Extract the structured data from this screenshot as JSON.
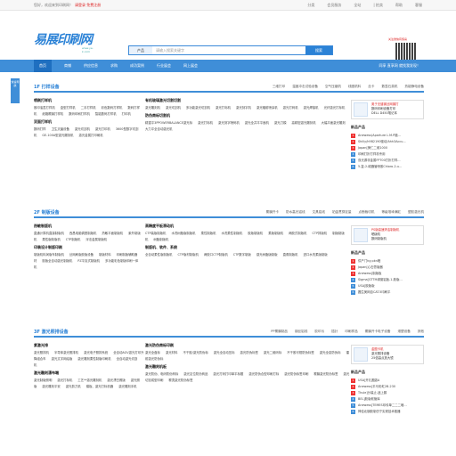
{
  "topbar": {
    "welcome": "您好，欢迎来到印刷网！",
    "register": "请登录 免费注册",
    "links": [
      "分类",
      "会员服务",
      "全站",
      "| 拍卖",
      "帮助",
      "客服"
    ]
  },
  "logo": {
    "text": "易展印刷网",
    "sub": "www.ye-k.com"
  },
  "search": {
    "category": "产品",
    "placeholder": "请输入搜索关键字",
    "button": "搜索"
  },
  "qr": {
    "label": "关注微信有惊喜"
  },
  "nav": {
    "items": [
      "首页",
      "商铺",
      "供应信息",
      "求购",
      "成功案例",
      "行业展会",
      "网上展会"
    ],
    "right": "同享 直享网 就找我发现！"
  },
  "side_tab": {
    "label": "快速导航"
  },
  "sections": [
    {
      "title": "1F 打样设备",
      "links": [
        "三维打印",
        "温度冲击试验设备",
        "空气压缩机",
        "线圈机料",
        "丝卡",
        "数显石英机",
        "热能静电设备"
      ],
      "cols": [
        {
          "groups": [
            {
              "title": "喷刷打样机",
              "items": [
                "胶印油墨打样机",
                "盒型打样机",
                "二手打样机",
                "彩色数码打样机",
                "数码打样机",
                "纸箱覆膜打样机",
                "数码印刷打样机",
                "智能数码打样机",
                "打印机"
              ]
            },
            {
              "title": "双面打样机",
              "items": [
                "数码打样",
                "卫生灭菌设备",
                "激光切割机",
                "激光打印机",
                "3600型数字切割机",
                "GE-100A型激光雕刻机",
                "激光金属打印刷机"
              ]
            }
          ]
        },
        {
          "groups": [
            {
              "title": "有机玻璃激光切割切割",
              "items": [
                "激光雕刻机",
                "激光切割机",
                "多功能激光切割机",
                "激光打标机",
                "激光刻字机",
                "激光辐射喷涂机",
                "激光打码机",
                "激光焊接机",
                "光纤激光打标机"
              ]
            },
            {
              "title": "防伪商标切割机",
              "items": [
                "精重平3PPOWERBALANCE激光标",
                "激光打标机",
                "激光刻字喷码机",
                "激光全并平平面机",
                "激光刀模",
                "高精密激光雕刻机",
                "大幅平面激光雕刻",
                "大力平全自动激光机"
              ]
            }
          ]
        }
      ],
      "side": {
        "promo": {
          "highlight": "奥于无缝钢丝网钢打",
          "lines": [
            "数码印刷设备打印",
            "DELL D450笔记本"
          ]
        },
        "rank_title": "新品产品",
        "rank": [
          "Anewess(Aparture L.M.P植...",
          "Shilly/h9B2190驱动/Ahh3Accu...",
          "Japan[美仁二维1000",
          "印刷打折打样机专用",
          "双光源非金属FPT00打折打样...",
          "5-复-2-磁器管喷胶Chloro-2-u..."
        ]
      }
    },
    {
      "title": "2F 制版设备",
      "links": [
        "覆膜开卡",
        "防水高光铝线",
        "文具铝线",
        "铂金贯穿定量",
        "点断裁切机",
        "等级堆垛满缸",
        "塑胶激光机"
      ],
      "cols": [
        {
          "groups": [
            {
              "title": "热敏制版机",
              "items": [
                "直通计算机直接制版机",
                "西昌电脑调宽制版机",
                "热敏平面制版机",
                "紫外制版机",
                "柔性版制版机",
                "CTP制版机",
                "浮法金属制版机"
              ]
            },
            {
              "title": "印装设计制版印刷",
              "items": [
                "制版机料润版车制版机",
                "丝网刷版胶版设备",
                "制版材料",
                "印刷制版辅助器材",
                "胶版全自动激光制版机",
                "PZ平克式制版机",
                "多功能彩色制版印刷一体机"
              ]
            }
          ]
        },
        {
          "groups": [
            {
              "title": "高精度平板滑动机",
              "items": [
                "CTP装版制版机",
                "水洗树脂版制版机",
                "柔性制版机",
                "水洗柔性制版机",
                "胶版制版机",
                "柔版制版机",
                "两胶式制版机",
                "CTP排版机",
                "制版制版机",
                "树脂制版机"
              ]
            },
            {
              "title": "制版机、软件、系统",
              "items": [
                "全自动柔性版制版机",
                "CTP版材制版机",
                "两胶口CTP制版机",
                "CTP数字制版",
                "感光树脂版制版",
                "直角制版机",
                "进口水洗柔版制版"
              ]
            }
          ]
        }
      ],
      "side": {
        "promo": {
          "highlight": "PS版高速清洁制版机",
          "lines": [
            "晒版机",
            "数码制版机"
          ]
        },
        "rank_title": "新品产品",
        "rank": [
          "供产门hg pkn晒",
          "Japan[心石膏版器",
          "Anewess]制版板",
          "Sigma[GTTM绿窗铝板-1-胶版...",
          "USA]胶版版",
          "圆生美网自CAT.5印刷平"
        ]
      }
    },
    {
      "title": "3F 激光照排设备",
      "links": [
        "PP覆膜制品",
        "钢丝铝线",
        "胶印污",
        "插针",
        "印刷样品",
        "覆膜开卡电子设备",
        "滚塑设备",
        "其他"
      ],
      "cols": [
        {
          "groups": [
            {
              "title": "紫激光排",
              "items": [
                "激光照排机",
                "半导体激光照排机",
                "激光电子照排系统",
                "全自动AGV激光打印升降组合车",
                "激光文字网绘版",
                "激光雕刻柔性制版印刷机",
                "全自动激光切割机"
              ]
            },
            {
              "title": "激光雕刻漂布端",
              "items": [
                "激光制版照明",
                "激光打标机",
                "工艺**激光雕刻机",
                "激光漂白照版",
                "激光照版",
                "激光雕刻平安",
                "激光剪刀机",
                "模板、激光打标机器",
                "激光雕刻手机"
              ]
            }
          ]
        },
        {
          "groups": [
            {
              "title": "激光防伪商标印刷",
              "items": [
                "激光全盘标",
                "激光材料",
                "不干胶/激光防伪标",
                "激光全自动压标",
                "激光防伪标签",
                "激光二维码标",
                "不干胶可视防伪标签",
                "激光全息防伪标",
                "镭射激光防伪标"
              ]
            },
            {
              "title": "激光雕刻机板",
              "items": [
                "激光防伪、电码防伪商标",
                "激光定位防伪商品",
                "激光打码打印单平标题",
                "激光防伪合型印刷打标",
                "激光防伪标签印刷",
                "覆膜激光防伪标签",
                "激光切割成型印刷",
                "覆烫激光防伪标签"
              ]
            }
          ]
        }
      ],
      "side": {
        "promo": {
          "highlight": "金图卡机",
          "lines": [
            "激光照排设备",
            "25倍高点放大镜"
          ]
        },
        "rank_title": "新品产品",
        "rank": [
          "USA]开孔圆激A",
          "Anewess]平马彩虹2B-230",
          "Thule]分装止-迷上藤",
          "BEL]胶版软管库",
          "Anewess]TEMES印传单二二二暗...",
          "神佳北钢胶制仿宁实现技术推器"
        ]
      }
    }
  ]
}
